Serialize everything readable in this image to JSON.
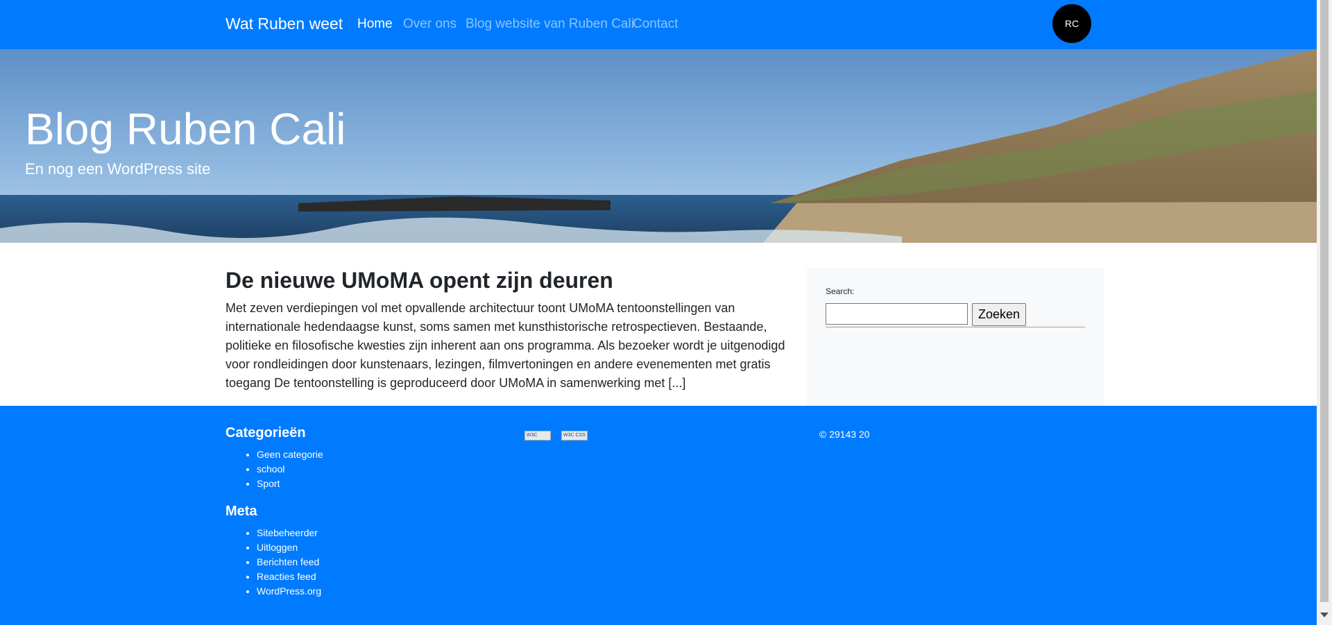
{
  "navbar": {
    "brand": "Wat Ruben weet",
    "items": [
      {
        "label": "Home",
        "active": true
      },
      {
        "label": "Over ons",
        "active": false
      },
      {
        "label": "Blog website van Ruben Cali",
        "active": false
      },
      {
        "label": "Contact",
        "active": false
      }
    ],
    "avatar_initials": "RC"
  },
  "hero": {
    "title": "Blog Ruben Cali",
    "subtitle": "En nog een WordPress site"
  },
  "post": {
    "title": "De nieuwe UMoMA opent zijn deuren",
    "excerpt": "Met zeven verdiepingen vol met opvallende architectuur toont UMoMA tentoonstellingen van internationale hedendaagse kunst, soms samen met kunsthistorische retrospectieven. Bestaande, politieke en filosofische kwesties zijn inherent aan ons programma. Als bezoeker wordt je uitgenodigd voor rondleidingen door kunstenaars, lezingen, filmvertoningen en andere evenementen met gratis toegang De tentoonstelling is geproduceerd door UMoMA in samenwerking met [...]"
  },
  "sidebar": {
    "search_label": "Search:",
    "search_value": "",
    "search_button": "Zoeken"
  },
  "footer": {
    "categories_title": "Categorieën",
    "categories": [
      "Geen categorie",
      "school",
      "Sport"
    ],
    "meta_title": "Meta",
    "meta": [
      "Sitebeheerder",
      "Uitloggen",
      "Berichten feed",
      "Reacties feed",
      "WordPress.org"
    ],
    "badges": [
      "W3C HTML",
      "W3C CSS"
    ],
    "copyright": "© 29143 20"
  },
  "colors": {
    "primary": "#007bff",
    "avatar_bg": "#000000",
    "sidebar_bg": "#f8f9fa"
  }
}
